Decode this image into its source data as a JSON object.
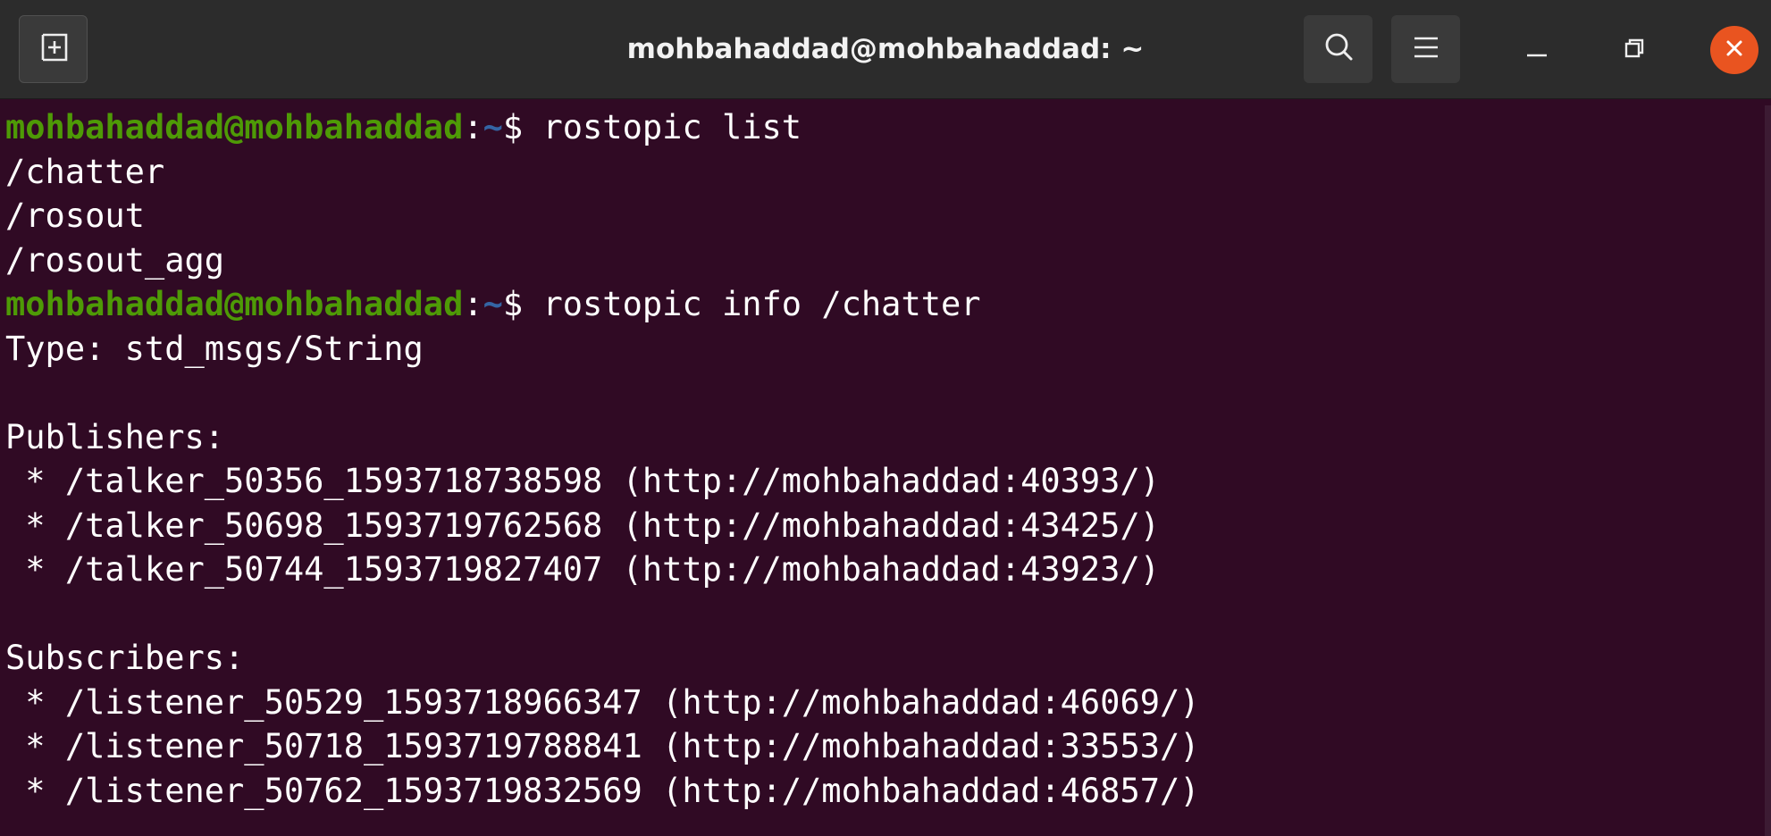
{
  "window": {
    "title": "mohbahaddad@mohbahaddad: ~"
  },
  "titlebar_icons": {
    "new_tab": "new-tab-icon",
    "search": "search-icon",
    "menu": "hamburger-menu-icon",
    "minimize": "minimize-icon",
    "maximize": "restore-icon",
    "close": "close-icon"
  },
  "colors": {
    "terminal_bg": "#300a24",
    "prompt_user": "#4e9a06",
    "prompt_path": "#3465a4",
    "close_button": "#e95420"
  },
  "prompt": {
    "user_host": "mohbahaddad@mohbahaddad",
    "separator": ":",
    "path": "~",
    "dollar": "$ "
  },
  "terminal": {
    "lines": [
      {
        "type": "prompt",
        "command": "rostopic list"
      },
      {
        "type": "output",
        "text": "/chatter"
      },
      {
        "type": "output",
        "text": "/rosout"
      },
      {
        "type": "output",
        "text": "/rosout_agg"
      },
      {
        "type": "prompt",
        "command": "rostopic info /chatter"
      },
      {
        "type": "output",
        "text": "Type: std_msgs/String"
      },
      {
        "type": "output",
        "text": ""
      },
      {
        "type": "output",
        "text": "Publishers:"
      },
      {
        "type": "output",
        "text": " * /talker_50356_1593718738598 (http://mohbahaddad:40393/)"
      },
      {
        "type": "output",
        "text": " * /talker_50698_1593719762568 (http://mohbahaddad:43425/)"
      },
      {
        "type": "output",
        "text": " * /talker_50744_1593719827407 (http://mohbahaddad:43923/)"
      },
      {
        "type": "output",
        "text": ""
      },
      {
        "type": "output",
        "text": "Subscribers:"
      },
      {
        "type": "output",
        "text": " * /listener_50529_1593718966347 (http://mohbahaddad:46069/)"
      },
      {
        "type": "output",
        "text": " * /listener_50718_1593719788841 (http://mohbahaddad:33553/)"
      },
      {
        "type": "output",
        "text": " * /listener_50762_1593719832569 (http://mohbahaddad:46857/)"
      }
    ]
  }
}
